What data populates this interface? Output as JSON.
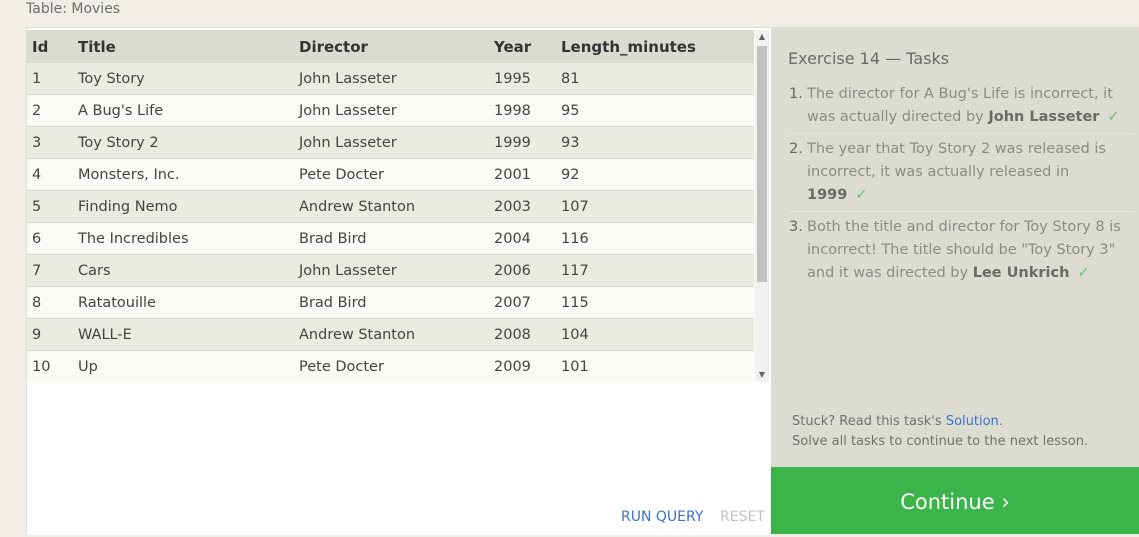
{
  "table_caption": "Table: Movies",
  "table": {
    "columns": [
      "Id",
      "Title",
      "Director",
      "Year",
      "Length_minutes"
    ],
    "rows": [
      [
        "1",
        "Toy Story",
        "John Lasseter",
        "1995",
        "81"
      ],
      [
        "2",
        "A Bug's Life",
        "John Lasseter",
        "1998",
        "95"
      ],
      [
        "3",
        "Toy Story 2",
        "John Lasseter",
        "1999",
        "93"
      ],
      [
        "4",
        "Monsters, Inc.",
        "Pete Docter",
        "2001",
        "92"
      ],
      [
        "5",
        "Finding Nemo",
        "Andrew Stanton",
        "2003",
        "107"
      ],
      [
        "6",
        "The Incredibles",
        "Brad Bird",
        "2004",
        "116"
      ],
      [
        "7",
        "Cars",
        "John Lasseter",
        "2006",
        "117"
      ],
      [
        "8",
        "Ratatouille",
        "Brad Bird",
        "2007",
        "115"
      ],
      [
        "9",
        "WALL-E",
        "Andrew Stanton",
        "2008",
        "104"
      ],
      [
        "10",
        "Up",
        "Pete Docter",
        "2009",
        "101"
      ]
    ]
  },
  "query_actions": {
    "run_label": "RUN QUERY",
    "reset_label": "RESET"
  },
  "exercise": {
    "title": "Exercise 14 — Tasks",
    "tasks": [
      {
        "num": "1.",
        "text": "The director for A Bug's Life is incorrect, it was actually directed by",
        "strong": "John Lasseter",
        "check": "✓"
      },
      {
        "num": "2.",
        "text": "The year that Toy Story 2 was released is incorrect, it was actually released in",
        "strong": "1999",
        "check": "✓"
      },
      {
        "num": "3.",
        "text": "Both the title and director for Toy Story 8 is incorrect! The title should be \"Toy Story 3\" and it was directed by",
        "strong": "Lee Unkrich",
        "check": "✓"
      }
    ],
    "help_prefix": "Stuck? Read this task's",
    "solution_link": "Solution",
    "help_suffix": ".",
    "help_line2": "Solve all tasks to continue to the next lesson."
  },
  "continue_label": "Continue ›",
  "colors": {
    "continue_bg": "#3bb54a",
    "link": "#3a74c4",
    "check": "#6cc070"
  },
  "icons": {
    "scroll_up": "▲",
    "scroll_down": "▼"
  }
}
